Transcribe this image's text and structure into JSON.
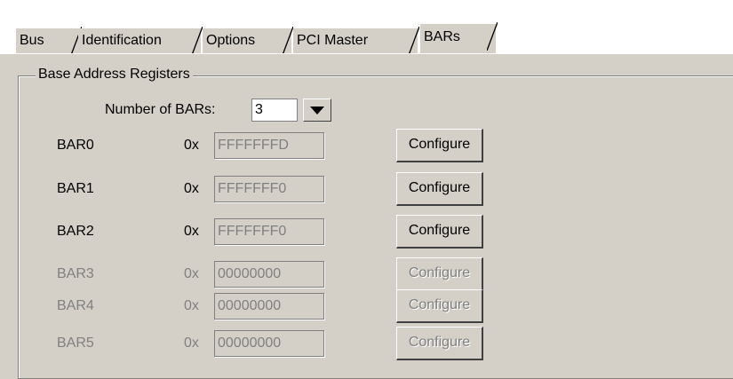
{
  "tabs": [
    {
      "label": "Bus",
      "active": false
    },
    {
      "label": "Identification",
      "active": false
    },
    {
      "label": "Options",
      "active": false
    },
    {
      "label": "PCI Master",
      "active": false
    },
    {
      "label": "BARs",
      "active": true
    }
  ],
  "group": {
    "title": "Base Address Registers"
  },
  "num_bars": {
    "label": "Number of BARs:",
    "value": "3"
  },
  "hex_prefix": "0x",
  "bars": [
    {
      "name": "BAR0",
      "value": "FFFFFFFD",
      "button": "Configure",
      "enabled": true
    },
    {
      "name": "BAR1",
      "value": "FFFFFFF0",
      "button": "Configure",
      "enabled": true
    },
    {
      "name": "BAR2",
      "value": "FFFFFFF0",
      "button": "Configure",
      "enabled": true
    },
    {
      "name": "BAR3",
      "value": "00000000",
      "button": "Configure",
      "enabled": false
    },
    {
      "name": "BAR4",
      "value": "00000000",
      "button": "Configure",
      "enabled": false
    },
    {
      "name": "BAR5",
      "value": "00000000",
      "button": "Configure",
      "enabled": false
    }
  ]
}
